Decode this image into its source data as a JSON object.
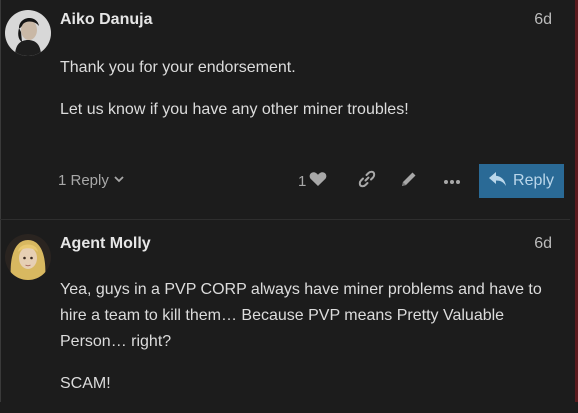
{
  "posts": [
    {
      "username": "Aiko Danuja",
      "date": "6d",
      "paragraphs": [
        "Thank you for your endorsement.",
        "Let us know if you have any other miner troubles!"
      ],
      "replies_label": "1 Reply",
      "likes_count": "1",
      "reply_button_label": "Reply"
    },
    {
      "username": "Agent Molly",
      "date": "6d",
      "paragraphs": [
        "Yea, guys in a PVP CORP always have miner problems and have to hire a team to kill them… Because PVP means Pretty Valuable Person… right?",
        "SCAM!"
      ]
    }
  ],
  "colors": {
    "background": "#1c1c1c",
    "reply_button": "#2a6a96",
    "text": "#dcdcdc"
  }
}
